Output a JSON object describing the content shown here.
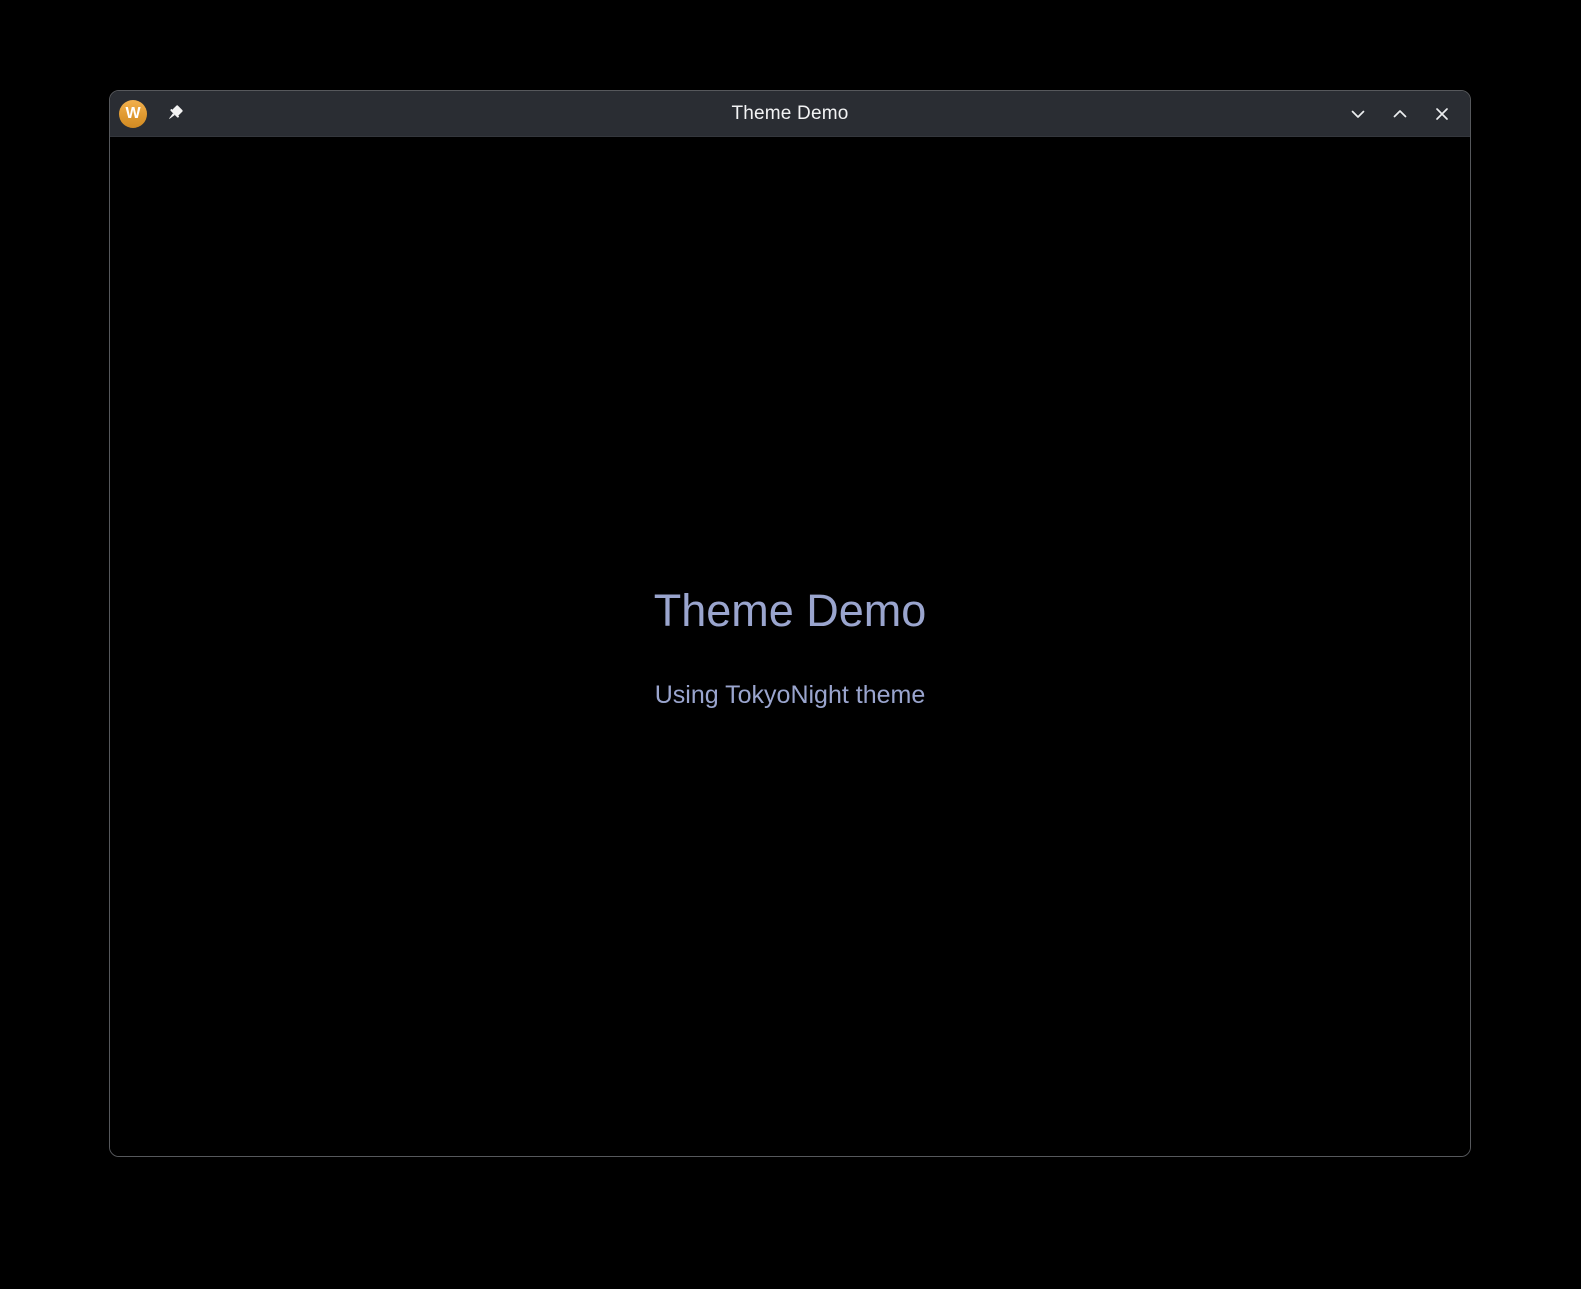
{
  "window": {
    "title": "Theme Demo",
    "app_icon": {
      "name": "wayland-logo-icon",
      "letter": "W",
      "color": "#e09a30"
    },
    "titlebar": {
      "background": "#2a2d33",
      "pin_icon": "pushpin-icon",
      "controls": [
        {
          "name": "minimize-button",
          "icon": "chevron-down-icon"
        },
        {
          "name": "maximize-button",
          "icon": "chevron-up-icon"
        },
        {
          "name": "close-button",
          "icon": "close-icon"
        }
      ]
    },
    "border_color": "#56585c"
  },
  "main": {
    "heading": "Theme Demo",
    "subtitle": "Using TokyoNight theme",
    "text_color": "#9aa5ce",
    "background": "#000000"
  }
}
